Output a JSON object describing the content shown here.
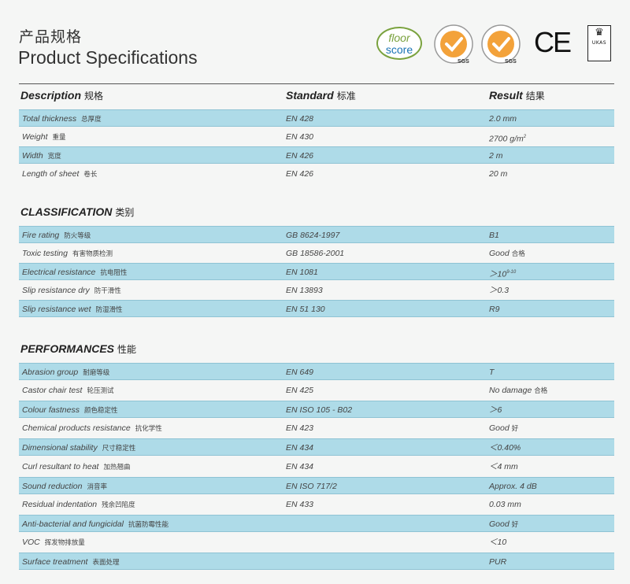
{
  "title": {
    "cn": "产品规格",
    "en": "Product Specifications"
  },
  "certifications": {
    "floorscore_line1": "floor",
    "floorscore_line2": "score",
    "sgs_mark": "SGS",
    "ce_mark": "CE",
    "ukas_label": "UKAS",
    "icons": [
      "floorscore-logo",
      "sgs-iso9001-seal",
      "sgs-iso14001-seal",
      "ce-mark",
      "ukas-logo"
    ]
  },
  "columns": {
    "description": "Description",
    "description_cn": "规格",
    "standard": "Standard",
    "standard_cn": "标准",
    "result": "Result",
    "result_cn": "结果"
  },
  "sections": {
    "basic": {
      "rows": [
        {
          "name": "Total thickness",
          "name_cn": "总厚度",
          "standard": "EN 428",
          "result": "2.0 mm"
        },
        {
          "name": "Weight",
          "name_cn": "重量",
          "standard": "EN 430",
          "result": "2700 g/m",
          "result_sup": "2"
        },
        {
          "name": "Width",
          "name_cn": "宽度",
          "standard": "EN 426",
          "result": "2 m"
        },
        {
          "name": "Length of sheet",
          "name_cn": "卷长",
          "standard": "EN 426",
          "result": "20 m"
        }
      ]
    },
    "classification": {
      "title": "CLASSIFICATION",
      "title_cn": "类别",
      "rows": [
        {
          "name": "Fire rating",
          "name_cn": "防火等级",
          "standard": "GB 8624-1997",
          "result": "B1"
        },
        {
          "name": "Toxic testing",
          "name_cn": "有害物质检测",
          "standard": "GB 18586-2001",
          "result": "Good",
          "result_cn": "合格"
        },
        {
          "name": "Electrical resistance",
          "name_cn": "抗电阻性",
          "standard": "EN 1081",
          "result": "＞10",
          "result_sup": "9-10"
        },
        {
          "name": "Slip resistance dry",
          "name_cn": "防干滑性",
          "standard": "EN 13893",
          "result": "＞0.3"
        },
        {
          "name": "Slip resistance wet",
          "name_cn": "防湿滑性",
          "standard": "EN 51 130",
          "result": "R9"
        }
      ]
    },
    "performances": {
      "title": "PERFORMANCES",
      "title_cn": "性能",
      "rows": [
        {
          "name": "Abrasion group",
          "name_cn": "耐磨等级",
          "standard": "EN 649",
          "result": "T"
        },
        {
          "name": "Castor chair test",
          "name_cn": "轮压测试",
          "standard": "EN 425",
          "result": "No damage",
          "result_cn": "合格"
        },
        {
          "name": "Colour fastness",
          "name_cn": "颜色稳定性",
          "standard": "EN ISO 105 - B02",
          "result": "＞6"
        },
        {
          "name": "Chemical products resistance",
          "name_cn": "抗化学性",
          "standard": "EN 423",
          "result": "Good",
          "result_cn": "好"
        },
        {
          "name": "Dimensional stability",
          "name_cn": "尺寸稳定性",
          "standard": "EN 434",
          "result": "＜0.40%"
        },
        {
          "name": "Curl resultant to heat",
          "name_cn": "加热翘曲",
          "standard": "EN 434",
          "result": "＜4 mm"
        },
        {
          "name": "Sound reduction",
          "name_cn": "消音率",
          "standard": "EN ISO 717/2",
          "result": "Approx. 4 dB"
        },
        {
          "name": "Residual indentation",
          "name_cn": "残余凹陷度",
          "standard": "EN 433",
          "result": "0.03 mm"
        },
        {
          "name": "Anti-bacterial and fungicidal",
          "name_cn": "抗菌防霉性能",
          "standard": "",
          "result": "Good",
          "result_cn": "好"
        },
        {
          "name": "VOC",
          "name_cn": "挥发物排放量",
          "standard": "",
          "result": "＜10"
        },
        {
          "name": "Surface treatment",
          "name_cn": "表面处理",
          "standard": "",
          "result": "PUR"
        }
      ]
    }
  },
  "colors": {
    "row_shade": "#aedbe8",
    "background": "#f5f6f5"
  }
}
